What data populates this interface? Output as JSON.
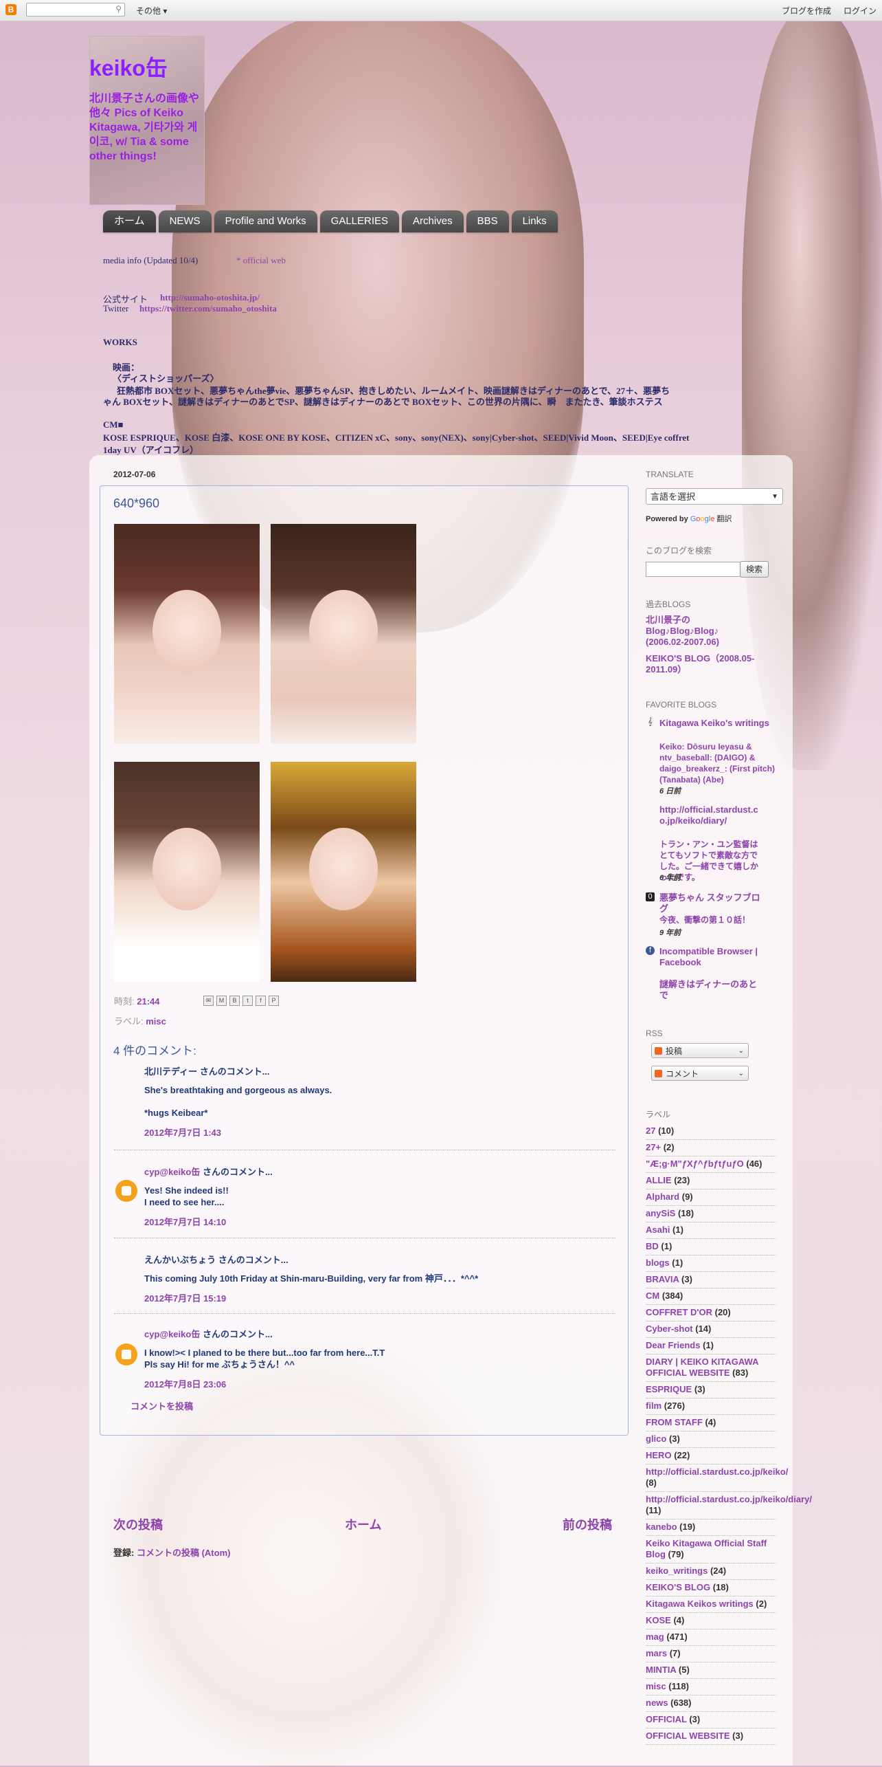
{
  "navbar": {
    "logo": "B",
    "more_label": "その他 ▾",
    "create_blog": "ブログを作成",
    "login": "ログイン"
  },
  "header": {
    "title": "keiko缶",
    "description": "北川景子さんの画像や他々 Pics of Keiko Kitagawa, 기타가와 게이코, w/ Tia & some other things!"
  },
  "tabs": [
    {
      "label": "ホーム",
      "selected": true
    },
    {
      "label": "NEWS"
    },
    {
      "label": "Profile and Works"
    },
    {
      "label": "GALLERIES"
    },
    {
      "label": "Archives"
    },
    {
      "label": "BBS"
    },
    {
      "label": "Links"
    }
  ],
  "top_texts": {
    "line1": "media info (Updated 10/4)",
    "line1_link": "* official web",
    "line2_label": "公式サイト",
    "line2_url": "http://sumaho-otoshita.jp/",
    "line3_label": "Twitter",
    "line3_url": "https://twitter.com/sumaho_otoshita",
    "line4": "WORKS",
    "line5": "映画：",
    "line6": "〈ディストショッパーズ〉",
    "line7": "狂熱都市 BOXセット、悪夢ちゃんthe夢vie、悪夢ちゃんSP、抱きしめたい、ルームメイト、映画謎解きはディナーのあとで、27＋、悪夢ち",
    "line8": "ゃん BOXセット、謎解きはディナーのあとでSP、謎解きはディナーのあとで BOXセット、この世界の片隅に、瞬　またたき、筆談ホステス",
    "cm_heading": "CM■",
    "cm_line1": "KOSE ESPRIQUE、KOSE 白漆、KOSE ONE BY KOSE、CITIZEN xC、sony、sony(NEX)、sony|Cyber-shot、SEED|Vivid Moon、SEED|Eye coffret",
    "cm_line2": "1day UV（アイコフレ）"
  },
  "post": {
    "date": "2012-07-06",
    "title": "640*960",
    "time_label": "時刻:",
    "time_value": "21:44",
    "labels_label": "ラベル:",
    "label_value": "misc",
    "comments_title": "4 件のコメント:",
    "comments": [
      {
        "author": "北川テディー さんのコメント...",
        "author_link": "",
        "body1": "She's breathtaking and gorgeous as always.",
        "body2": "*hugs Keibear*",
        "ts": "2012年7月7日 1:43"
      },
      {
        "author": " さんのコメント...",
        "author_link": "cyp@keiko缶",
        "body1": "Yes! She indeed is!!",
        "body2": "I need to see her....",
        "ts": "2012年7月7日 14:10"
      },
      {
        "author": "えんかいぶちょう さんのコメント...",
        "author_link": "",
        "body1": "This coming July 10th Friday at Shin-maru-Building, very far from 神戸．．．*^^*",
        "body2": "",
        "ts": "2012年7月7日 15:19"
      },
      {
        "author": " さんのコメント...",
        "author_link": "cyp@keiko缶",
        "body1": "I know!>< I planed to be there but...too far from here...T.T",
        "body2": "Pls say Hi! for me ぶちょうさん！^^",
        "ts": "2012年7月8日 23:06"
      }
    ],
    "post_comment": "コメントを投稿"
  },
  "pager": {
    "newer": "次の投稿",
    "home": "ホーム",
    "older": "前の投稿"
  },
  "subscribe": {
    "label": "登録:",
    "link": "コメントの投稿 (Atom)"
  },
  "sidebar": {
    "translate_heading": "TRANSLATE",
    "translate_select": "言語を選択",
    "powered_by": "Powered by",
    "google": [
      "G",
      "o",
      "o",
      "g",
      "l",
      "e"
    ],
    "translate_word": "翻訳",
    "search_heading": "このブログを検索",
    "search_button": "検索",
    "past_heading": "過去BLOGS",
    "past_links": [
      "北川景子の Blog♪Blog♪Blog♪ (2006.02-2007.06)",
      "KEIKO'S BLOG（2008.05-2011.09）"
    ],
    "fav_heading": "FAVORITE BLOGS",
    "favorites": [
      {
        "icon": "𝄞",
        "title": "Kitagawa Keiko's writings",
        "snippet": "Keiko: Dōsuru Ieyasu & ntv_baseball: (DAIGO) & daigo_breakerz_: (First pitch) (Tanabata) (Abe)",
        "age": "6 日前"
      },
      {
        "icon": "",
        "title": "http://official.stardust.co.jp/keiko/diary/",
        "snippet": "トラン・アン・ユン監督はとてもソフトで素敵な方でした。ご一緒できて嬉しかったです。",
        "age": "6 年前"
      },
      {
        "icon": "0",
        "title": "悪夢ちゃん スタッフブログ",
        "snippet": "今夜、衝撃の第１０話！",
        "age": "9 年前"
      },
      {
        "icon": "f",
        "title": "Incompatible Browser | Facebook",
        "snippet": "",
        "age": ""
      },
      {
        "icon": "",
        "title": "謎解きはディナーのあとで",
        "snippet": "",
        "age": ""
      }
    ],
    "rss_heading": "RSS",
    "rss_posts": "投稿",
    "rss_comments": "コメント",
    "labels_heading": "ラベル",
    "labels": [
      {
        "name": "27",
        "count": "(10)"
      },
      {
        "name": "27+",
        "count": "(2)"
      },
      {
        "name": "\"Æ;g·M\"ƒXƒ^ƒbƒtƒuƒO",
        "count": "(46)"
      },
      {
        "name": "ALLIE",
        "count": "(23)"
      },
      {
        "name": "Alphard",
        "count": "(9)"
      },
      {
        "name": "anySiS",
        "count": "(18)"
      },
      {
        "name": "Asahi",
        "count": "(1)"
      },
      {
        "name": "BD",
        "count": "(1)"
      },
      {
        "name": "blogs",
        "count": "(1)"
      },
      {
        "name": "BRAVIA",
        "count": "(3)"
      },
      {
        "name": "CM",
        "count": "(384)"
      },
      {
        "name": "COFFRET D'OR",
        "count": "(20)"
      },
      {
        "name": "Cyber-shot",
        "count": "(14)"
      },
      {
        "name": "Dear Friends",
        "count": "(1)"
      },
      {
        "name": "DIARY | KEIKO KITAGAWA OFFICIAL WEBSITE",
        "count": "(83)"
      },
      {
        "name": "ESPRIQUE",
        "count": "(3)"
      },
      {
        "name": "film",
        "count": "(276)"
      },
      {
        "name": "FROM STAFF",
        "count": "(4)"
      },
      {
        "name": "glico",
        "count": "(3)"
      },
      {
        "name": "HERO",
        "count": "(22)"
      },
      {
        "name": "http://official.stardust.co.jp/keiko/",
        "count": "(8)"
      },
      {
        "name": "http://official.stardust.co.jp/keiko/diary/",
        "count": "(11)"
      },
      {
        "name": "kanebo",
        "count": "(19)"
      },
      {
        "name": "Keiko Kitagawa Official Staff Blog",
        "count": "(79)"
      },
      {
        "name": "keiko_writings",
        "count": "(24)"
      },
      {
        "name": "KEIKO'S BLOG",
        "count": "(18)"
      },
      {
        "name": "Kitagawa Keikos writings",
        "count": "(2)"
      },
      {
        "name": "KOSE",
        "count": "(4)"
      },
      {
        "name": "mag",
        "count": "(471)"
      },
      {
        "name": "mars",
        "count": "(7)"
      },
      {
        "name": "MINTIA",
        "count": "(5)"
      },
      {
        "name": "misc",
        "count": "(118)"
      },
      {
        "name": "news",
        "count": "(638)"
      },
      {
        "name": "OFFICIAL",
        "count": "(3)"
      },
      {
        "name": "OFFICIAL WEBSITE",
        "count": "(3)"
      }
    ]
  }
}
